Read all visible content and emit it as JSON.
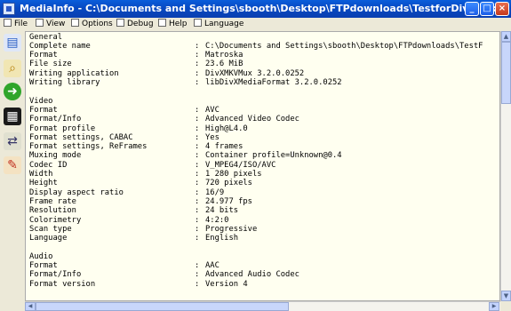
{
  "window": {
    "title": "MediaInfo - C:\\Documents and Settings\\sbooth\\Desktop\\FTPdownloads\\TestforDivX.mkv"
  },
  "menu": [
    {
      "label": "File"
    },
    {
      "label": "View"
    },
    {
      "label": "Options"
    },
    {
      "label": "Debug"
    },
    {
      "label": "Help"
    },
    {
      "label": "Language"
    }
  ],
  "sidebar_icons": [
    "basic-view-icon",
    "sheet-view-icon",
    "next-arrow-icon",
    "text-view-icon",
    "export-icon",
    "edit-icon"
  ],
  "rows": [
    {
      "k": "General",
      "v": ""
    },
    {
      "k": "Complete name",
      "v": "C:\\Documents and Settings\\sbooth\\Desktop\\FTPdownloads\\TestF"
    },
    {
      "k": "Format",
      "v": "Matroska"
    },
    {
      "k": "File size",
      "v": "23.6 MiB"
    },
    {
      "k": "Writing application",
      "v": "DivXMKVMux 3.2.0.0252"
    },
    {
      "k": "Writing library",
      "v": "libDivXMediaFormat 3.2.0.0252"
    },
    {
      "k": "",
      "v": ""
    },
    {
      "k": "Video",
      "v": ""
    },
    {
      "k": "Format",
      "v": "AVC"
    },
    {
      "k": "Format/Info",
      "v": "Advanced Video Codec"
    },
    {
      "k": "Format profile",
      "v": "High@L4.0"
    },
    {
      "k": "Format settings, CABAC",
      "v": "Yes"
    },
    {
      "k": "Format settings, ReFrames",
      "v": "4 frames"
    },
    {
      "k": "Muxing mode",
      "v": "Container profile=Unknown@0.4"
    },
    {
      "k": "Codec ID",
      "v": "V_MPEG4/ISO/AVC"
    },
    {
      "k": "Width",
      "v": "1 280 pixels"
    },
    {
      "k": "Height",
      "v": "720 pixels"
    },
    {
      "k": "Display aspect ratio",
      "v": "16/9"
    },
    {
      "k": "Frame rate",
      "v": "24.977 fps"
    },
    {
      "k": "Resolution",
      "v": "24 bits"
    },
    {
      "k": "Colorimetry",
      "v": "4:2:0"
    },
    {
      "k": "Scan type",
      "v": "Progressive"
    },
    {
      "k": "Language",
      "v": "English"
    },
    {
      "k": "",
      "v": ""
    },
    {
      "k": "Audio",
      "v": ""
    },
    {
      "k": "Format",
      "v": "AAC"
    },
    {
      "k": "Format/Info",
      "v": "Advanced Audio Codec"
    },
    {
      "k": "Format version",
      "v": "Version 4"
    }
  ]
}
